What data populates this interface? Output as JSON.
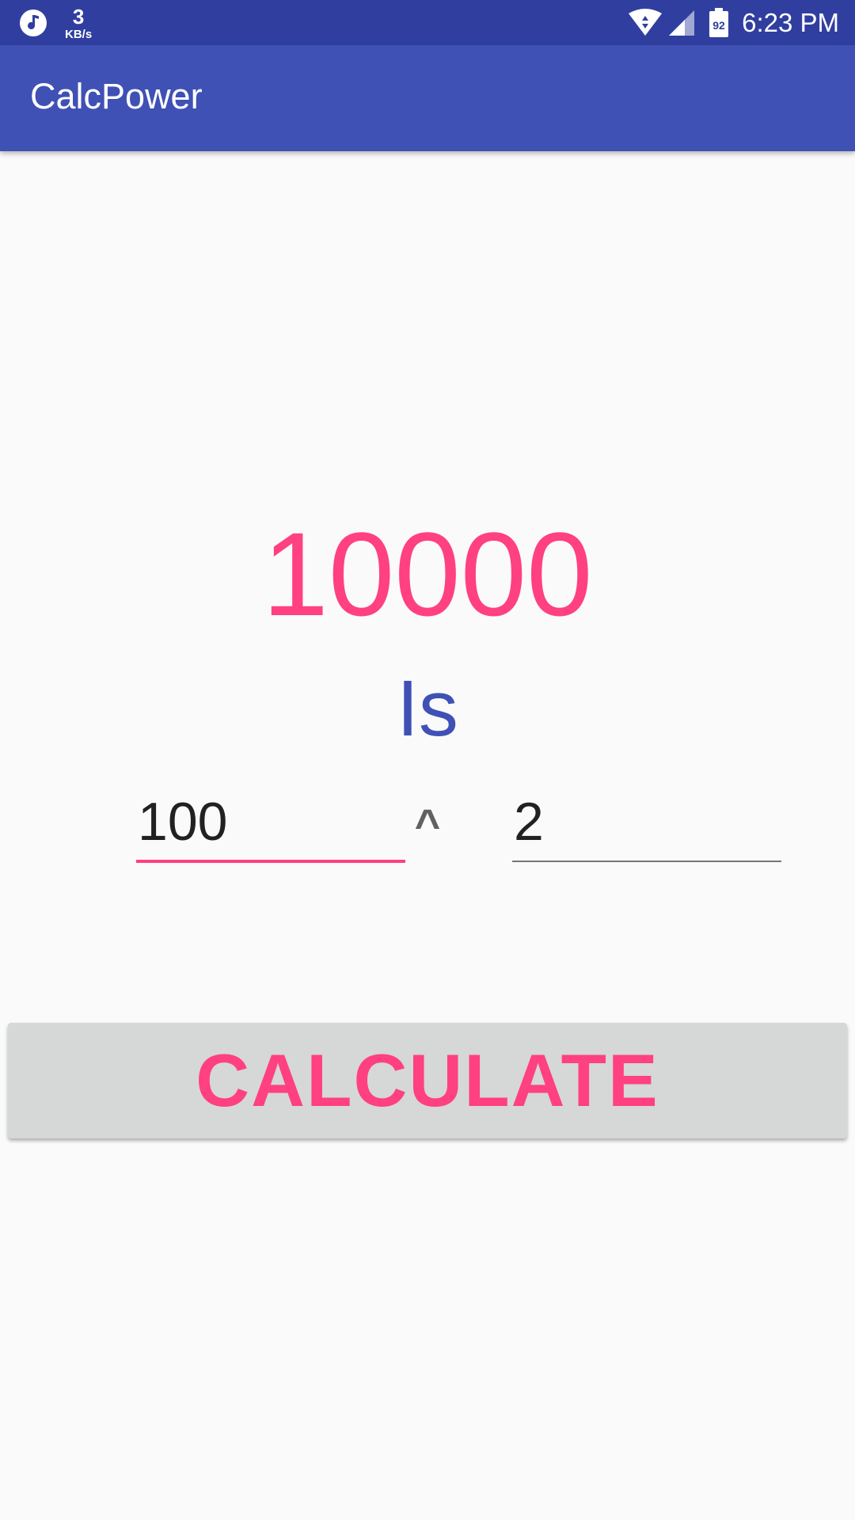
{
  "status_bar": {
    "net_speed_value": "3",
    "net_speed_unit": "KB/s",
    "battery_level": "92",
    "time": "6:23 PM",
    "icons": [
      "music-icon",
      "wifi-icon",
      "signal-icon",
      "battery-icon"
    ]
  },
  "app_bar": {
    "title": "CalcPower"
  },
  "main": {
    "result": "10000",
    "is_label": "Is",
    "base_value": "100",
    "operator": "^",
    "exponent_value": "2",
    "calculate_label": "CALCULATE"
  },
  "colors": {
    "status_bar": "#303f9f",
    "primary": "#3f51b5",
    "accent": "#ff4081",
    "button_bg": "#d6d7d7",
    "background": "#fafafa"
  }
}
